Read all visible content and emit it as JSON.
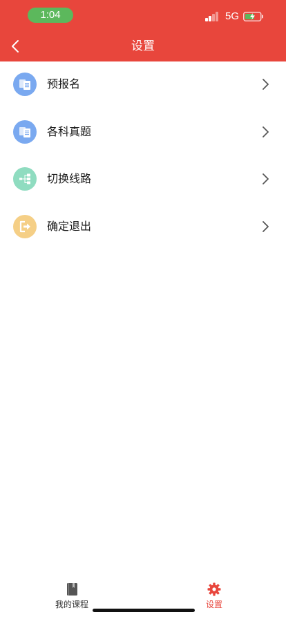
{
  "status_bar": {
    "time": "1:04",
    "network": "5G"
  },
  "header": {
    "title": "设置"
  },
  "menu": {
    "items": [
      {
        "label": "预报名",
        "icon": "documents-icon",
        "color": "#7aa9f0"
      },
      {
        "label": "各科真题",
        "icon": "documents-icon",
        "color": "#7aa9f0"
      },
      {
        "label": "切换线路",
        "icon": "route-icon",
        "color": "#8fdcc0"
      },
      {
        "label": "确定退出",
        "icon": "logout-icon",
        "color": "#f5cf86"
      }
    ]
  },
  "tabbar": {
    "tabs": [
      {
        "label": "我的课程",
        "icon": "book-icon",
        "active": false
      },
      {
        "label": "设置",
        "icon": "gear-icon",
        "active": true
      }
    ]
  },
  "colors": {
    "brand": "#e8463c",
    "tab_inactive": "#333333"
  }
}
